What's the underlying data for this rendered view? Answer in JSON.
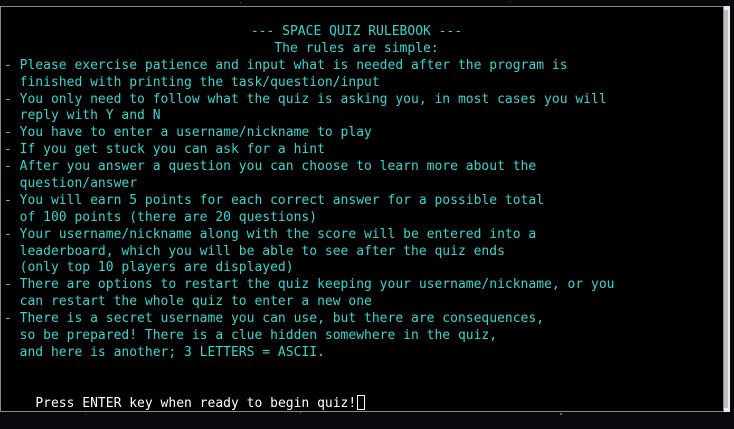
{
  "terminal": {
    "header": "--- SPACE QUIZ RULEBOOK ---",
    "subheader": "The rules are simple:",
    "rules": [
      "- Please exercise patience and input what is needed after the program is",
      "  finished with printing the task/question/input",
      "- You only need to follow what the quiz is asking you, in most cases you will",
      "  reply with Y and N",
      "- You have to enter a username/nickname to play",
      "- If you get stuck you can ask for a hint",
      "- After you answer a question you can choose to learn more about the",
      "  question/answer",
      "- You will earn 5 points for each correct answer for a possible total",
      "  of 100 points (there are 20 questions)",
      "- Your username/nickname along with the score will be entered into a",
      "  leaderboard, which you will be able to see after the quiz ends",
      "  (only top 10 players are displayed)",
      "- There are options to restart the quiz keeping your username/nickname, or you",
      "  can restart the whole quiz to enter a new one",
      "- There is a secret username you can use, but there are consequences,",
      "  so be prepared! There is a clue hidden somewhere in the quiz,",
      "  and here is another; 3 LETTERS = ASCII."
    ],
    "prompt": "Press ENTER key when ready to begin quiz!"
  },
  "colors": {
    "text": "#36d6d0",
    "prompt": "#ffffff",
    "background": "#000000"
  }
}
